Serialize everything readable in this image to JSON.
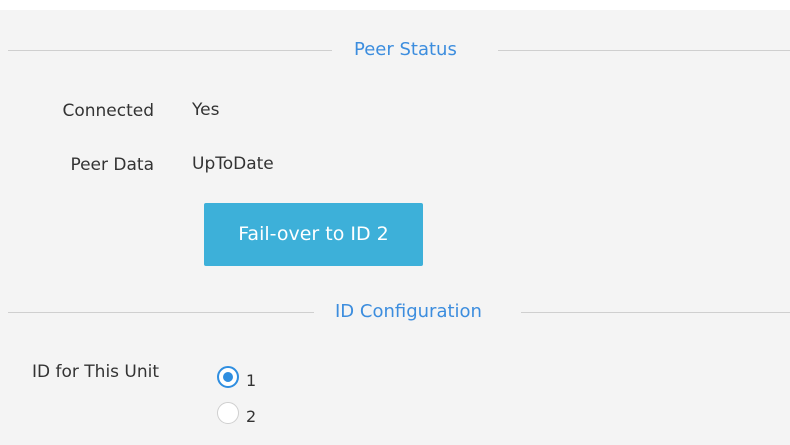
{
  "peer_status": {
    "section_title": "Peer Status",
    "connected_label": "Connected",
    "connected_value": "Yes",
    "peer_data_label": "Peer Data",
    "peer_data_value": "UpToDate",
    "failover_button_label": "Fail-over to ID 2"
  },
  "id_configuration": {
    "section_title": "ID Configuration",
    "id_label": "ID for This Unit",
    "options": [
      {
        "label": "1",
        "selected": true
      },
      {
        "label": "2",
        "selected": false
      }
    ]
  },
  "colors": {
    "accent": "#3c8dde",
    "button_bg": "#3db0d9",
    "panel_bg": "#f4f4f4",
    "radio_accent": "#2f8ee0"
  }
}
